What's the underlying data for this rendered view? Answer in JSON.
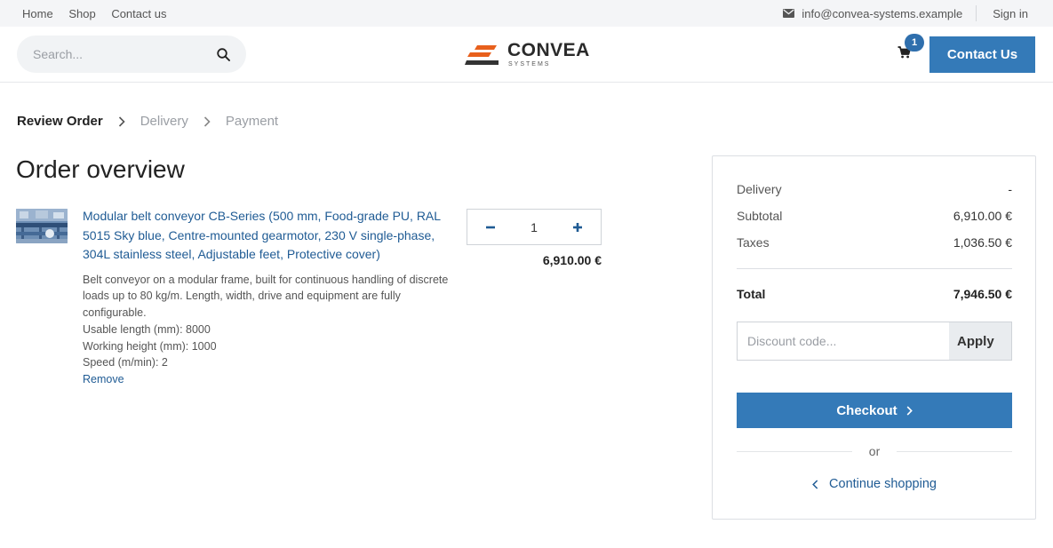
{
  "topbar": {
    "nav": [
      "Home",
      "Shop",
      "Contact us"
    ],
    "email": "info@convea-systems.example",
    "signin": "Sign in"
  },
  "header": {
    "search_placeholder": "Search...",
    "logo_brand": "CONVEA",
    "logo_sub": "SYSTEMS",
    "cart_count": "1",
    "contact_label": "Contact Us"
  },
  "steps": [
    "Review Order",
    "Delivery",
    "Payment"
  ],
  "page_title": "Order overview",
  "item": {
    "title": "Modular belt conveyor CB-Series (500 mm, Food-grade PU, RAL 5015 Sky blue, Centre-mounted gearmotor, 230 V single-phase, 304L stainless steel, Adjustable feet, Protective cover)",
    "description": "Belt conveyor on a modular frame, built for continuous handling of discrete loads up to 80 kg/m. Length, width, drive and equipment are fully configurable.",
    "specs": [
      "Usable length (mm): 8000",
      "Working height (mm): 1000",
      "Speed (m/min): 2"
    ],
    "remove_label": "Remove",
    "quantity": "1",
    "price": "6,910.00 €"
  },
  "summary": {
    "delivery_label": "Delivery",
    "delivery_value": "-",
    "subtotal_label": "Subtotal",
    "subtotal_value": "6,910.00 €",
    "taxes_label": "Taxes",
    "taxes_value": "1,036.50 €",
    "total_label": "Total",
    "total_value": "7,946.50 €",
    "discount_placeholder": "Discount code...",
    "apply_label": "Apply",
    "checkout_label": "Checkout",
    "or_label": "or",
    "continue_label": "Continue shopping"
  },
  "colors": {
    "primary": "#347ab8",
    "link": "#1f5b94",
    "logo_orange": "#e8601c"
  }
}
